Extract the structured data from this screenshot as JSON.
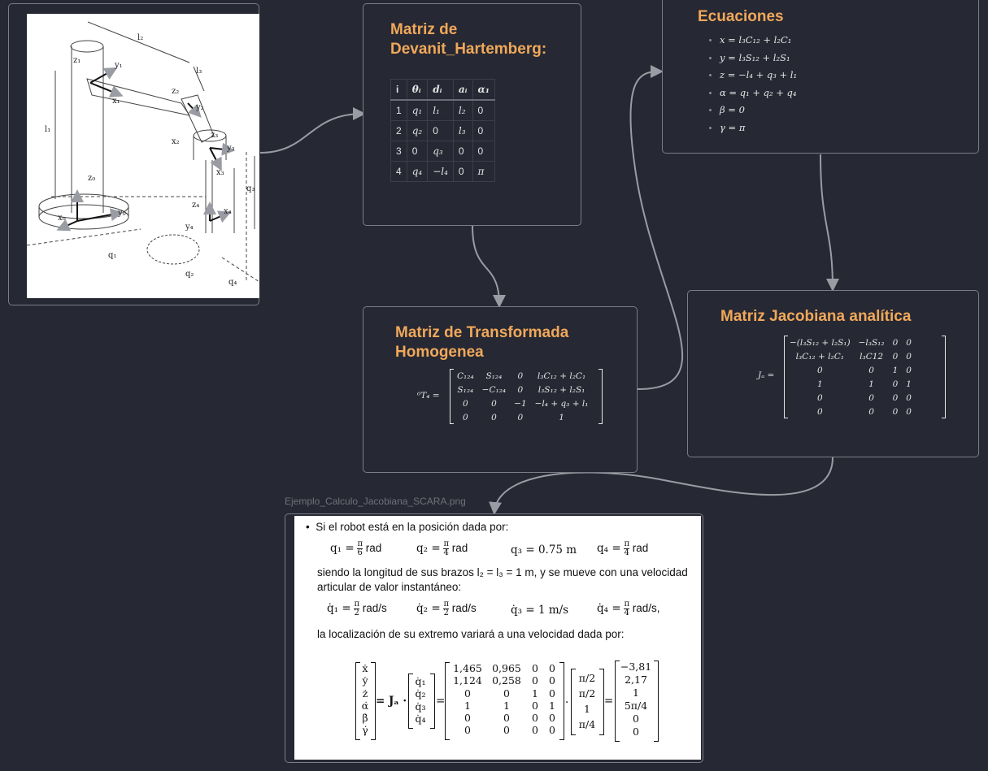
{
  "nodes": {
    "dh": {
      "title": "Matriz de Devanit_Hartemberg:",
      "headers": [
        "i",
        "θᵢ",
        "dᵢ",
        "aᵢ",
        "α₁"
      ],
      "rows": [
        [
          "1",
          "q₁",
          "l₁",
          "l₂",
          "0"
        ],
        [
          "2",
          "q₂",
          "0",
          "l₃",
          "0"
        ],
        [
          "3",
          "0",
          "q₃",
          "0",
          "0"
        ],
        [
          "4",
          "q₄",
          "−l₄",
          "0",
          "π"
        ]
      ]
    },
    "equations": {
      "title": "Ecuaciones",
      "items": [
        "x = l₃C₁₂ + l₂C₁",
        "y = l₃S₁₂ + l₂S₁",
        "z = −l₄ + q₃ + l₁",
        "α = q₁ + q₂ + q₄",
        "β = 0",
        "γ = π"
      ]
    },
    "transform": {
      "title": "Matriz de Transformada Homogenea",
      "label": "⁰T₄ =",
      "rows": [
        [
          "C₁₂₄",
          "S₁₂₄",
          "0",
          "l₃C₁₂ + l₂C₁"
        ],
        [
          "S₁₂₄",
          "−C₁₂₄",
          "0",
          "l₃S₁₂ + l₂S₁"
        ],
        [
          "0",
          "0",
          "−1",
          "−l₄ + q₃ + l₁"
        ],
        [
          "0",
          "0",
          "0",
          "1"
        ]
      ]
    },
    "jacobian": {
      "title": "Matriz Jacobiana analítica",
      "label": "Jₐ =",
      "rows": [
        [
          "−(l₃S₁₂ + l₂S₁)",
          "−l₃S₁₂",
          "0",
          "0"
        ],
        [
          "l₃C₁₂ + l₂C₁",
          "l₃C12",
          "0",
          "0"
        ],
        [
          "0",
          "0",
          "1",
          "0"
        ],
        [
          "1",
          "1",
          "0",
          "1"
        ],
        [
          "0",
          "0",
          "0",
          "0"
        ],
        [
          "0",
          "0",
          "0",
          "0"
        ]
      ]
    },
    "example": {
      "caption": "Ejemplo_Calculo_Jacobiana_SCARA.png",
      "line1": "Si el robot está en la posición dada por:",
      "q_values": [
        {
          "lhs": "q₁ =",
          "num": "π",
          "den": "6",
          "unit": "rad"
        },
        {
          "lhs": "q₂ =",
          "num": "π",
          "den": "4",
          "unit": "rad"
        },
        {
          "lhs": "q₃ = 0.75 m",
          "num": "",
          "den": "",
          "unit": ""
        },
        {
          "lhs": "q₄ =",
          "num": "π",
          "den": "4",
          "unit": "rad"
        }
      ],
      "line2": "siendo la longitud de sus brazos l₂ = l₃ = 1 m, y se mueve con una velocidad",
      "line3": "articular de valor instantáneo:",
      "qd_values": [
        {
          "lhs": "q̇₁ =",
          "num": "π",
          "den": "2",
          "unit": "rad/s"
        },
        {
          "lhs": "q̇₂ =",
          "num": "π",
          "den": "2",
          "unit": "rad/s"
        },
        {
          "lhs": "q̇₃ = 1 m/s",
          "num": "",
          "den": "",
          "unit": ""
        },
        {
          "lhs": "q̇₄ =",
          "num": "π",
          "den": "4",
          "unit": "rad/s,"
        }
      ],
      "line4": "la localización de su extremo variará a una velocidad dada por:",
      "vel_vector": [
        "ẋ",
        "ẏ",
        "ż",
        "α̇",
        "β̇",
        "γ̇"
      ],
      "ja_label": "= Jₐ ·",
      "qd_vector": [
        "q̇₁",
        "q̇₂",
        "q̇₃",
        "q̇₄"
      ],
      "num_matrix": [
        [
          "1,465",
          "0,965",
          "0",
          "0"
        ],
        [
          "1,124",
          "0,258",
          "0",
          "0"
        ],
        [
          "0",
          "0",
          "1",
          "0"
        ],
        [
          "1",
          "1",
          "0",
          "1"
        ],
        [
          "0",
          "0",
          "0",
          "0"
        ],
        [
          "0",
          "0",
          "0",
          "0"
        ]
      ],
      "qd_num_vector": [
        "π/2",
        "π/2",
        "1",
        "π/4"
      ],
      "result_vector": [
        "−3,81",
        "2,17",
        "1",
        "5π/4",
        "0",
        "0"
      ]
    },
    "robot_labels": {
      "l1": "l₁",
      "l2": "l₂",
      "l3": "l₃",
      "q1": "q₁",
      "q2": "q₂",
      "q3": "q₃",
      "q4": "q₄",
      "z0": "z₀",
      "x0": "x₀",
      "y0": "y₀",
      "z1": "z₁",
      "x1": "x₁",
      "y1": "y₁",
      "z2": "z₂",
      "x2": "x₂",
      "y2": "y₂",
      "z3": "z₃",
      "x3": "x₃",
      "y3": "y₃",
      "z4": "z₄",
      "x4": "x₄",
      "y4": "y₄"
    }
  }
}
